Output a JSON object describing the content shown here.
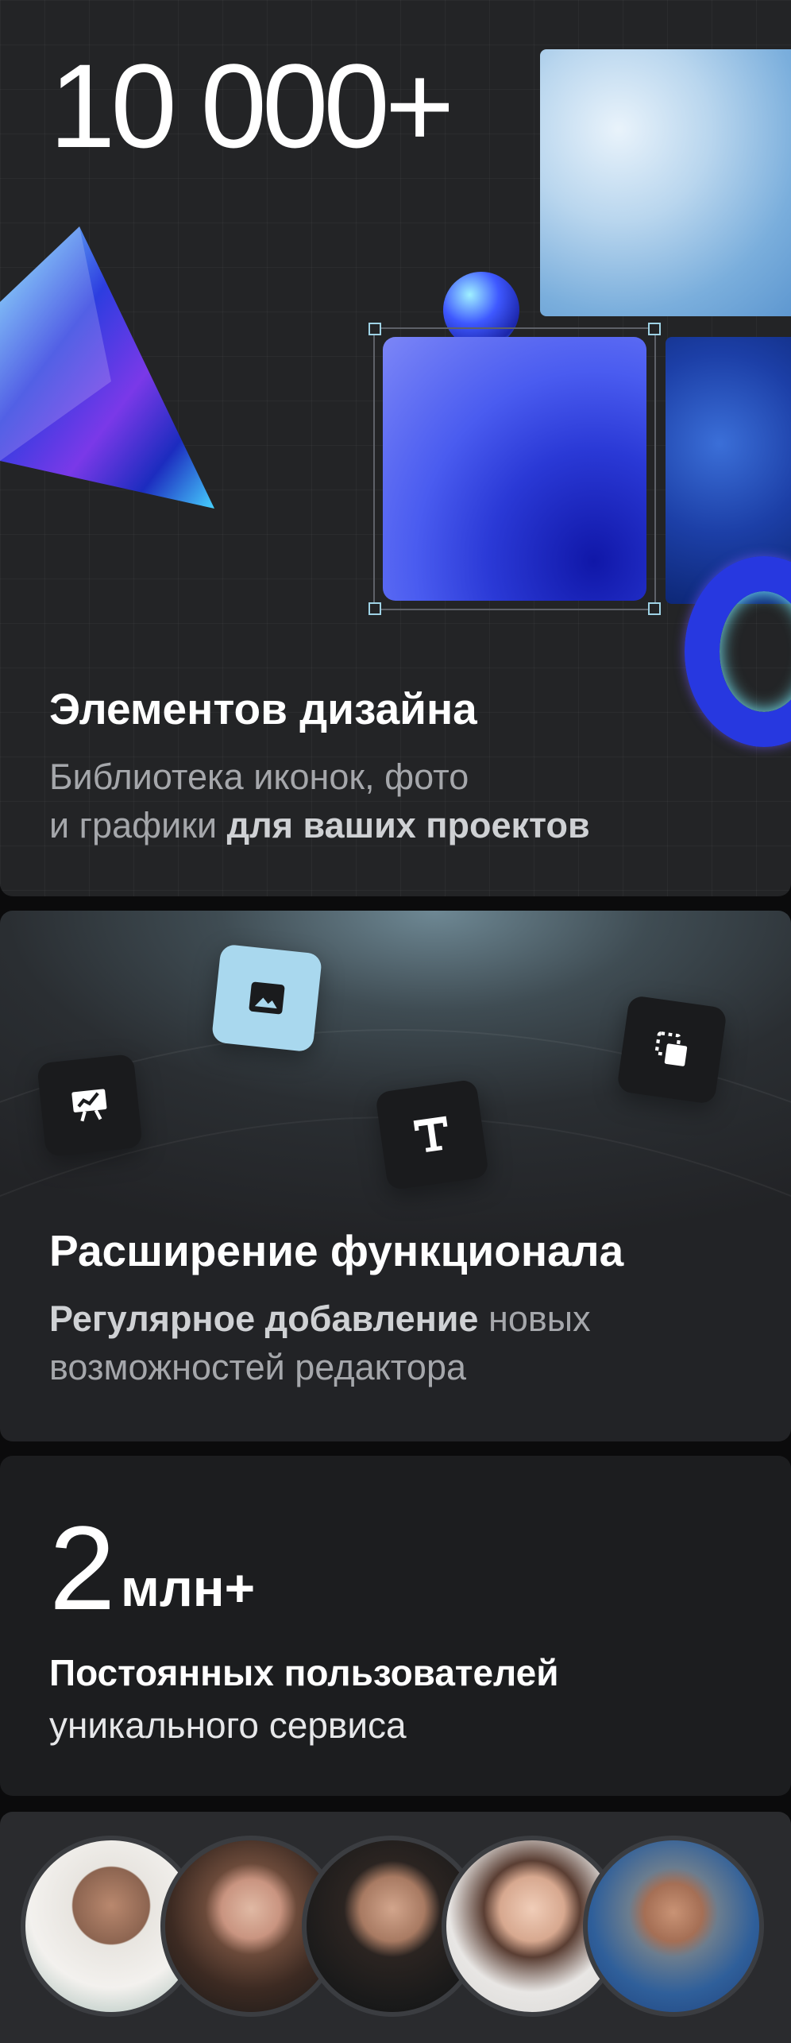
{
  "elements_card": {
    "count": "10 000+",
    "title": "Элементов дизайна",
    "subtitle_plain": "Библиотека иконок, фото",
    "subtitle_line2_plain": "и графики ",
    "subtitle_line2_bold": "для ваших проектов"
  },
  "features_card": {
    "title": "Расширение функционала",
    "subtitle_bold": "Регулярное добавление",
    "subtitle_plain": " новых",
    "subtitle_line2": "возможностей редактора",
    "tools": [
      "presentation-icon",
      "image-icon",
      "text-icon",
      "layers-icon"
    ]
  },
  "users_card": {
    "number": "2",
    "unit": "млн+",
    "title": "Постоянных пользователей",
    "subtitle": "уникального сервиса"
  },
  "avatars": [
    "avatar-man-curly",
    "avatar-woman-long-hair",
    "avatar-man-beard",
    "avatar-woman-dark-hair",
    "avatar-man-cap"
  ],
  "colors": {
    "accent_blue": "#2b3fd6",
    "card_bg": "#232426",
    "muted_text": "#a5a7ab"
  }
}
